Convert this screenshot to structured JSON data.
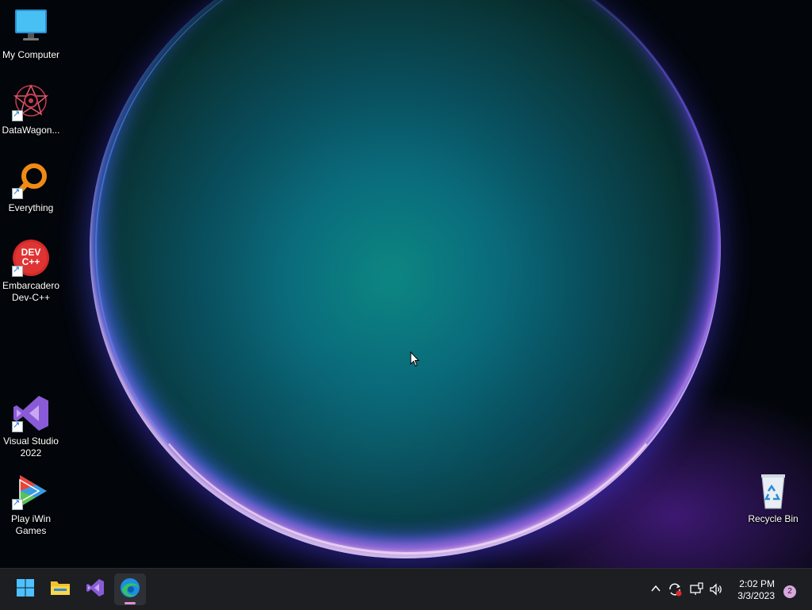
{
  "desktop_icons": [
    {
      "label": "My Computer",
      "icon": "monitor-icon"
    },
    {
      "label": "DataWagon...",
      "icon": "datawagon-icon"
    },
    {
      "label": "Everything",
      "icon": "search-magnifier-icon"
    },
    {
      "label": "Embarcadero Dev-C++",
      "icon": "devcpp-icon",
      "glyph_text": "DEV C++"
    },
    {
      "label": "Visual Studio 2022",
      "icon": "visual-studio-icon"
    },
    {
      "label": "Play iWin Games",
      "icon": "iwin-icon"
    },
    {
      "label": "Recycle Bin",
      "icon": "recycle-bin-icon"
    }
  ],
  "taskbar": {
    "pinned": [
      {
        "name": "start",
        "icon": "windows-start-icon"
      },
      {
        "name": "file-explorer",
        "icon": "folder-icon"
      },
      {
        "name": "visual-studio",
        "icon": "visual-studio-icon"
      },
      {
        "name": "edge",
        "icon": "edge-icon",
        "active": true
      }
    ],
    "tray": {
      "icons": [
        "chevron-up-icon",
        "sync-icon",
        "network-icon",
        "volume-icon"
      ],
      "time": "2:02 PM",
      "date": "3/3/2023",
      "notification_count": "2"
    }
  },
  "colors": {
    "taskbar_bg": "#1d1e22",
    "accent": "#e28fcd",
    "wallpaper_primary": "#0c8a86"
  }
}
